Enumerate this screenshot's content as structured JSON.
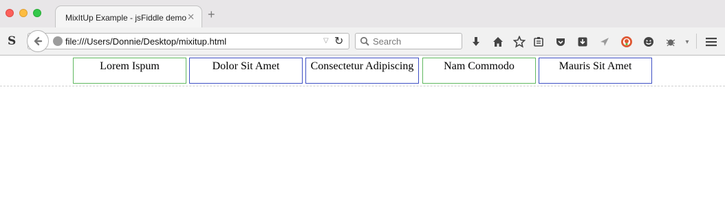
{
  "tab": {
    "title": "MixItUp Example - jsFiddle demo",
    "close_glyph": "✕",
    "new_tab_glyph": "+"
  },
  "toolbar": {
    "site_icon_letter": "S",
    "url": "file:///Users/Donnie/Desktop/mixitup.html",
    "search_placeholder": "Search"
  },
  "items": [
    {
      "label": "Lorem Ispum",
      "border": "green"
    },
    {
      "label": "Dolor Sit Amet",
      "border": "blue"
    },
    {
      "label": "Consectetur Adipiscing",
      "border": "blue"
    },
    {
      "label": "Nam Commodo",
      "border": "green"
    },
    {
      "label": "Mauris Sit Amet",
      "border": "blue"
    }
  ],
  "colors": {
    "green_border": "#5fb85f",
    "blue_border": "#3d4fc4"
  }
}
